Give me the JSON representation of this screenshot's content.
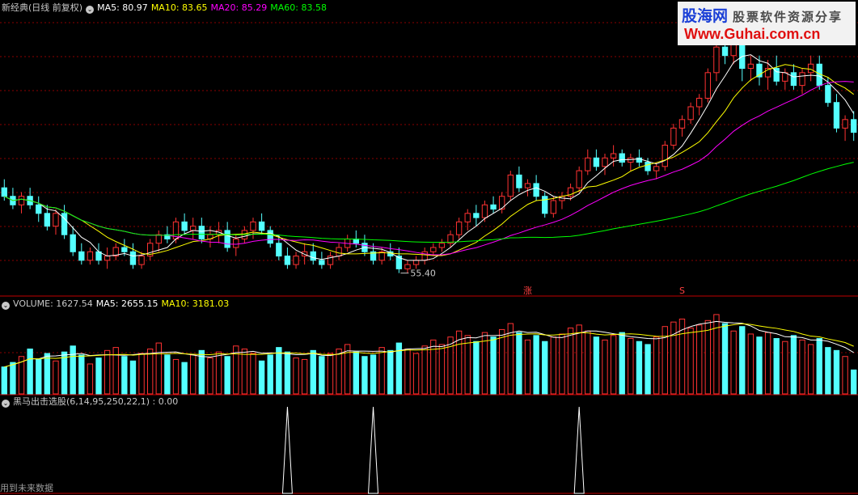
{
  "price_panel": {
    "title": "新经典(日线 前复权)",
    "ma5": "MA5: 80.97",
    "ma10": "MA10: 83.65",
    "ma20": "MA20: 85.29",
    "ma60": "MA60: 83.58",
    "low_label": "55.40",
    "marker_zhang": "涨",
    "marker_s": "S",
    "colors": {
      "ma5": "#ffffff",
      "ma10": "#ffff00",
      "ma20": "#ff00ff",
      "ma60": "#00ff00",
      "up": "#ff3232",
      "down": "#54ffff",
      "grid": "#8b0000",
      "panel_border": "#c00000"
    }
  },
  "volume_panel": {
    "label": "VOLUME: 1627.54",
    "ma5": "MA5: 2655.15",
    "ma10": "MA10: 3181.03"
  },
  "indicator_panel": {
    "label": "黑马出击选股(6,14,95,250,22,1) : 0.00"
  },
  "footer": {
    "text": "用到未来数据"
  },
  "logo": {
    "site": "股海网",
    "tagline": "股票软件资源分享",
    "url": "Www.Guhai.com.cn"
  },
  "chart_data": [
    {
      "type": "candlestick",
      "title": "新经典(日线 前复权)",
      "annotations": [
        "55.40",
        "涨",
        "S"
      ],
      "ylim": [
        50,
        116
      ],
      "candles": [
        [
          75,
          77,
          72,
          73
        ],
        [
          73,
          75,
          70,
          71
        ],
        [
          71,
          74,
          69,
          73
        ],
        [
          73,
          75,
          70,
          71
        ],
        [
          71,
          73,
          67,
          69
        ],
        [
          69,
          71,
          65,
          66
        ],
        [
          66,
          70,
          64,
          69
        ],
        [
          69,
          71,
          63,
          64
        ],
        [
          64,
          66,
          59,
          60
        ],
        [
          60,
          62,
          57,
          58
        ],
        [
          58,
          61,
          57,
          60
        ],
        [
          60,
          62,
          57,
          58
        ],
        [
          58,
          61,
          56,
          59
        ],
        [
          59,
          62,
          58,
          61
        ],
        [
          61,
          63,
          59,
          60
        ],
        [
          60,
          62,
          56,
          57
        ],
        [
          57,
          60,
          56,
          59
        ],
        [
          59,
          63,
          58,
          62
        ],
        [
          62,
          65,
          60,
          64
        ],
        [
          64,
          66,
          62,
          63
        ],
        [
          63,
          68,
          62,
          67
        ],
        [
          67,
          69,
          64,
          65
        ],
        [
          65,
          68,
          63,
          66
        ],
        [
          66,
          68,
          62,
          63
        ],
        [
          63,
          66,
          61,
          64
        ],
        [
          64,
          67,
          62,
          65
        ],
        [
          65,
          67,
          60,
          61
        ],
        [
          61,
          64,
          59,
          63
        ],
        [
          63,
          66,
          62,
          65
        ],
        [
          65,
          68,
          63,
          67
        ],
        [
          67,
          69,
          64,
          65
        ],
        [
          65,
          66,
          61,
          62
        ],
        [
          62,
          64,
          58,
          59
        ],
        [
          59,
          61,
          56,
          57
        ],
        [
          57,
          60,
          56,
          59
        ],
        [
          59,
          62,
          57,
          60
        ],
        [
          60,
          62,
          57,
          58
        ],
        [
          58,
          60,
          56,
          57
        ],
        [
          57,
          60,
          56,
          59
        ],
        [
          59,
          62,
          58,
          61
        ],
        [
          61,
          64,
          60,
          63
        ],
        [
          63,
          65,
          61,
          62
        ],
        [
          62,
          64,
          59,
          60
        ],
        [
          60,
          62,
          57,
          58
        ],
        [
          58,
          61,
          57,
          60
        ],
        [
          60,
          62,
          58,
          59
        ],
        [
          59,
          61,
          55,
          56
        ],
        [
          56,
          58,
          55,
          57
        ],
        [
          57,
          59,
          56,
          58
        ],
        [
          58,
          61,
          57,
          60
        ],
        [
          60,
          62,
          59,
          61
        ],
        [
          61,
          63,
          60,
          62
        ],
        [
          62,
          65,
          61,
          64
        ],
        [
          64,
          68,
          63,
          67
        ],
        [
          67,
          70,
          65,
          69
        ],
        [
          69,
          71,
          66,
          68
        ],
        [
          68,
          72,
          67,
          71
        ],
        [
          71,
          73,
          69,
          70
        ],
        [
          70,
          74,
          69,
          73
        ],
        [
          73,
          79,
          72,
          78
        ],
        [
          78,
          80,
          74,
          75
        ],
        [
          75,
          77,
          73,
          76
        ],
        [
          76,
          78,
          72,
          73
        ],
        [
          73,
          74,
          68,
          69
        ],
        [
          69,
          73,
          68,
          72
        ],
        [
          72,
          74,
          70,
          73
        ],
        [
          73,
          76,
          72,
          75
        ],
        [
          75,
          80,
          74,
          79
        ],
        [
          79,
          84,
          78,
          82
        ],
        [
          82,
          84,
          79,
          80
        ],
        [
          80,
          83,
          78,
          82
        ],
        [
          82,
          85,
          80,
          83
        ],
        [
          83,
          84,
          80,
          81
        ],
        [
          81,
          83,
          79,
          82
        ],
        [
          82,
          84,
          80,
          81
        ],
        [
          81,
          82,
          78,
          79
        ],
        [
          79,
          81,
          77,
          80
        ],
        [
          80,
          86,
          79,
          85
        ],
        [
          85,
          90,
          84,
          89
        ],
        [
          89,
          92,
          87,
          91
        ],
        [
          91,
          95,
          90,
          94
        ],
        [
          94,
          97,
          92,
          96
        ],
        [
          96,
          103,
          95,
          102
        ],
        [
          102,
          110,
          100,
          108
        ],
        [
          108,
          112,
          104,
          106
        ],
        [
          106,
          111,
          104,
          110
        ],
        [
          110,
          112,
          100,
          103
        ],
        [
          103,
          106,
          100,
          104
        ],
        [
          104,
          106,
          99,
          101
        ],
        [
          101,
          105,
          98,
          103
        ],
        [
          103,
          106,
          99,
          100
        ],
        [
          100,
          103,
          98,
          102
        ],
        [
          102,
          104,
          98,
          99
        ],
        [
          99,
          103,
          97,
          102
        ],
        [
          102,
          106,
          100,
          104
        ],
        [
          104,
          106,
          98,
          99
        ],
        [
          99,
          101,
          94,
          95
        ],
        [
          95,
          97,
          88,
          89
        ],
        [
          89,
          92,
          86,
          91
        ],
        [
          91,
          93,
          86,
          88
        ]
      ],
      "volume": [
        1800,
        2100,
        2500,
        3000,
        2300,
        2700,
        2200,
        2800,
        3200,
        2600,
        2000,
        2400,
        2900,
        3100,
        2500,
        2200,
        2700,
        3000,
        3400,
        2600,
        2300,
        2100,
        2600,
        2900,
        2400,
        2800,
        2500,
        3200,
        3000,
        2700,
        2200,
        2600,
        3100,
        2800,
        2400,
        2300,
        2900,
        2500,
        2700,
        3000,
        3300,
        2800,
        2500,
        2600,
        3100,
        2900,
        3400,
        3000,
        2700,
        3200,
        3600,
        3300,
        3800,
        4200,
        3900,
        3500,
        4100,
        3800,
        4300,
        4700,
        4100,
        3600,
        3900,
        3500,
        3800,
        4000,
        4400,
        4600,
        4200,
        3800,
        3600,
        3900,
        4100,
        3700,
        3500,
        3300,
        3800,
        4500,
        4800,
        5000,
        4400,
        4600,
        4900,
        5300,
        4700,
        4200,
        4500,
        4000,
        3800,
        4100,
        3700,
        3500,
        3900,
        3600,
        3300,
        3700,
        3100,
        2900,
        2500,
        1600
      ],
      "signals": [
        33,
        43,
        67
      ]
    }
  ]
}
